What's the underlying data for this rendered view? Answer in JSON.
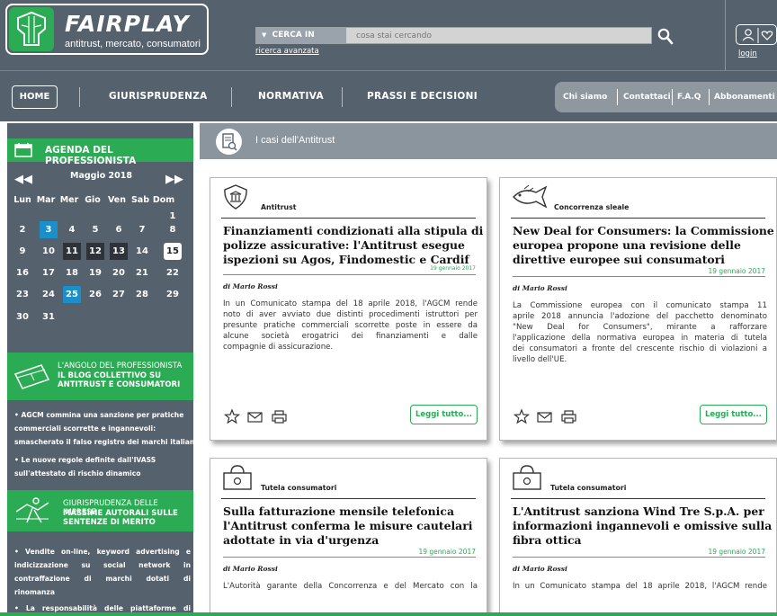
{
  "brand": {
    "name": "FAIRPLAY",
    "tagline": "antitrust, mercato, consumatori"
  },
  "search": {
    "scope_label": "CERCA IN",
    "placeholder": "cosa stai cercando",
    "advanced_link": "ricerca avanzata"
  },
  "account": {
    "login": "login"
  },
  "nav": {
    "home": "HOME",
    "items": [
      "GIURISPRUDENZA",
      "NORMATIVA",
      "PRASSI E DECISIONI"
    ],
    "utility": [
      "Chi siamo",
      "Contattaci",
      "F.A.Q",
      "Abbonamenti"
    ]
  },
  "agenda": {
    "title": "AGENDA DEL PROFESSIONISTA",
    "month": "Maggio 2018",
    "weekdays": [
      "Lun",
      "Mar",
      "Mer",
      "Gio",
      "Ven",
      "Sab",
      "Dom"
    ],
    "weeks": [
      [
        "",
        "",
        "",
        "",
        "",
        "",
        "1"
      ],
      [
        "2",
        "3",
        "4",
        "5",
        "6",
        "7",
        "8"
      ],
      [
        "9",
        "10",
        "11",
        "12",
        "13",
        "14",
        "15"
      ],
      [
        "16",
        "17",
        "18",
        "19",
        "20",
        "21",
        "22"
      ],
      [
        "23",
        "24",
        "25",
        "26",
        "27",
        "28",
        "29"
      ],
      [
        "30",
        "31",
        "",
        "",
        "",
        "",
        ""
      ]
    ]
  },
  "blog": {
    "kicker": "L'ANGOLO DEL PROFESSIONISTA",
    "title_1": "IL BLOG COLLETTIVO SU",
    "title_2": "ANTITRUST E CONSUMATORI",
    "news": [
      [
        "• AGCM commina una sanzione per pratiche",
        "commerciali scorrette e ingannevoli:",
        "smascherato il falso registro dei marchi italiani"
      ],
      [
        "• Le nuove regole definite dall'IVASS",
        "sull'attestato di rischio dinamico"
      ]
    ]
  },
  "jurisprudence": {
    "kicker": "GIURISPRUDENZA DELLE IMPRESE",
    "title_1": "MASSIME AUTORALI SULLE",
    "title_2": "SENTENZE DI MERITO",
    "news": [
      [
        "• Vendite on-line, keyword advertising e",
        "indicizzazione su social network in",
        "contraffazione di marchi dotati di",
        "rinomanza"
      ],
      [
        "• La responsabilità delle piattaforme di"
      ]
    ]
  },
  "main": {
    "section_title": "I casi dell'Antitrust",
    "read_more": "Leggi tutto..."
  },
  "cards": [
    {
      "category": "Antitrust",
      "title": [
        "Finanziamenti condizionati alla stipula di",
        "polizze assicurative: l'Antitrust esegue",
        "ispezioni su Agos, Findomestic e Cardif"
      ],
      "date": "19 gennaio 2017",
      "author": "di Mario Rossi",
      "body": [
        "In un Comunicato stampa del 18 aprile 2018, l'AGCM rende",
        "noto di aver avviato due distinti procedimenti istruttori per",
        "presunte pratiche commerciali scorrette poste in essere da",
        "alcune società erogatrici dei finanziamenti e dalle",
        "compagnie di assicurazione."
      ]
    },
    {
      "category": "Concorrenza sleale",
      "title": [
        "New Deal for Consumers: la Commissione",
        "europea propone una revisione delle",
        "direttive europee sui consumatori"
      ],
      "date": "19 gennaio 2017",
      "author": "di Mario Rossi",
      "body": [
        "La Commissione europea con il comunicato stampa 11",
        "aprile 2018 annuncia l'adozione del pacchetto denominato",
        "\"New Deal for Consumers\", mirante a rafforzare",
        "l'applicazione della normativa europea in materia di tutela",
        "dei consumatori a fronte del crescente rischio di violazioni a",
        "livello dell'UE."
      ]
    },
    {
      "category": "Tutela consumatori",
      "title": [
        "Sulla fatturazione mensile telefonica",
        "l'Antitrust conferma le misure cautelari",
        "adottate in via d'urgenza"
      ],
      "date": "19 gennaio 2017",
      "author": "di Mario Rossi",
      "body": [
        "L'Autorità garante della Concorrenza e del Mercato con la"
      ]
    },
    {
      "category": "Tutela consumatori",
      "title": [
        "L'Antitrust sanziona Wind Tre S.p.A. per",
        "informazioni ingannevoli e omissive sulla",
        "fibra ottica"
      ],
      "date": "19 gennaio 2017",
      "author": "di Mario Rossi",
      "body": [
        "In un Comunicato stampa del 18 aprile 2018, l'AGCM rende"
      ]
    }
  ],
  "colors": {
    "brand_green": "#2cab55",
    "slate": "#55616c",
    "highlight_blue": "#1b8fc9"
  }
}
